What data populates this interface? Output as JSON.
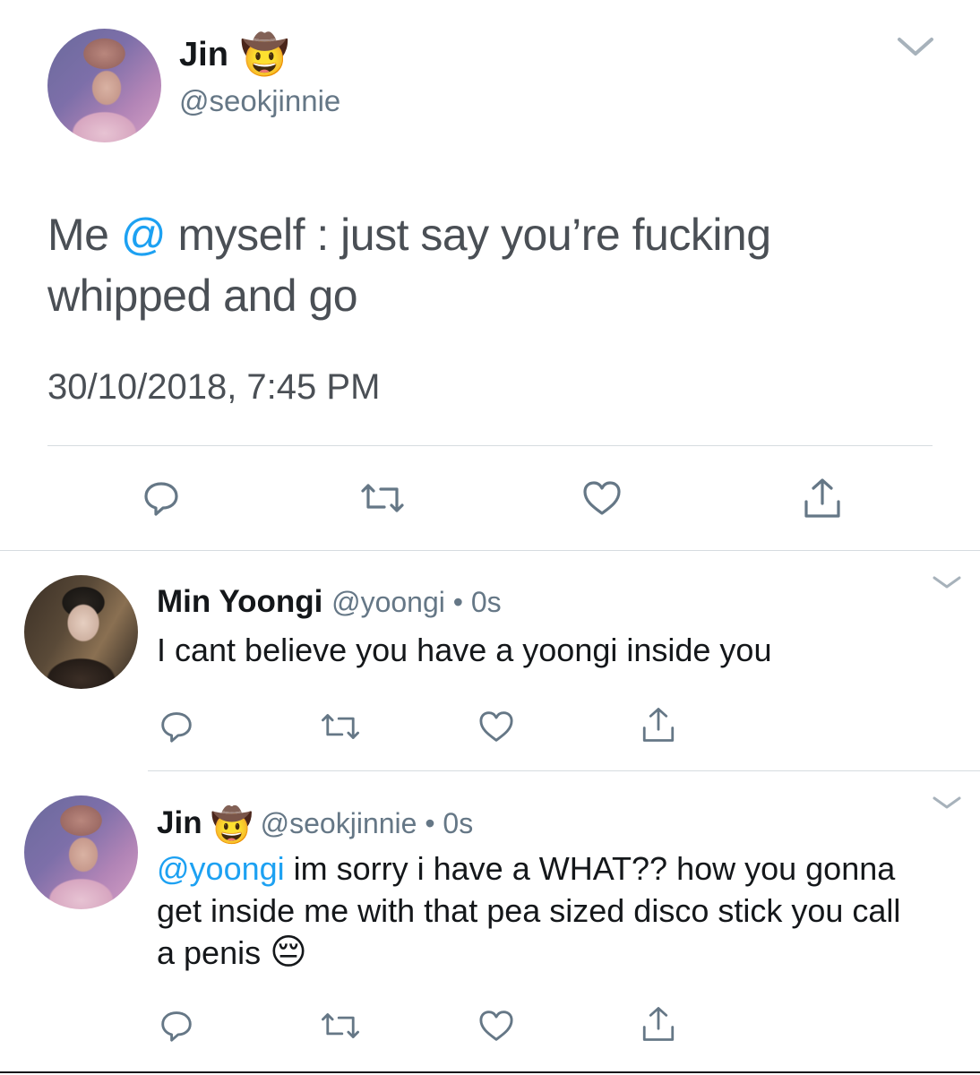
{
  "main_tweet": {
    "display_name": "Jin",
    "name_emoji": "🤠",
    "handle": "@seokjinnie",
    "text_prefix": "Me ",
    "text_mention": "@",
    "text_suffix": " myself : just say you’re fucking whipped and go",
    "timestamp": "30/10/2018, 7:45 PM"
  },
  "replies": [
    {
      "display_name": "Min Yoongi",
      "handle": "@yoongi",
      "separator": " • ",
      "time": "0s",
      "text": "I cant believe you have a yoongi inside you"
    },
    {
      "display_name": "Jin",
      "name_emoji": "🤠",
      "handle": "@seokjinnie",
      "separator": " • ",
      "time": "0s",
      "text_mention": "@yoongi",
      "text_body": " im sorry i have a WHAT?? how you gonna get inside me with that pea sized disco stick you call a penis ",
      "text_emoji": "😔"
    }
  ],
  "icons": {
    "reply": "reply-icon",
    "retweet": "retweet-icon",
    "like": "heart-icon",
    "share": "share-icon",
    "more": "chevron-down-icon"
  },
  "colors": {
    "mention": "#1da1f2",
    "secondary_text": "#657786",
    "icon_gray": "#657786",
    "divider": "#d6dce0"
  }
}
